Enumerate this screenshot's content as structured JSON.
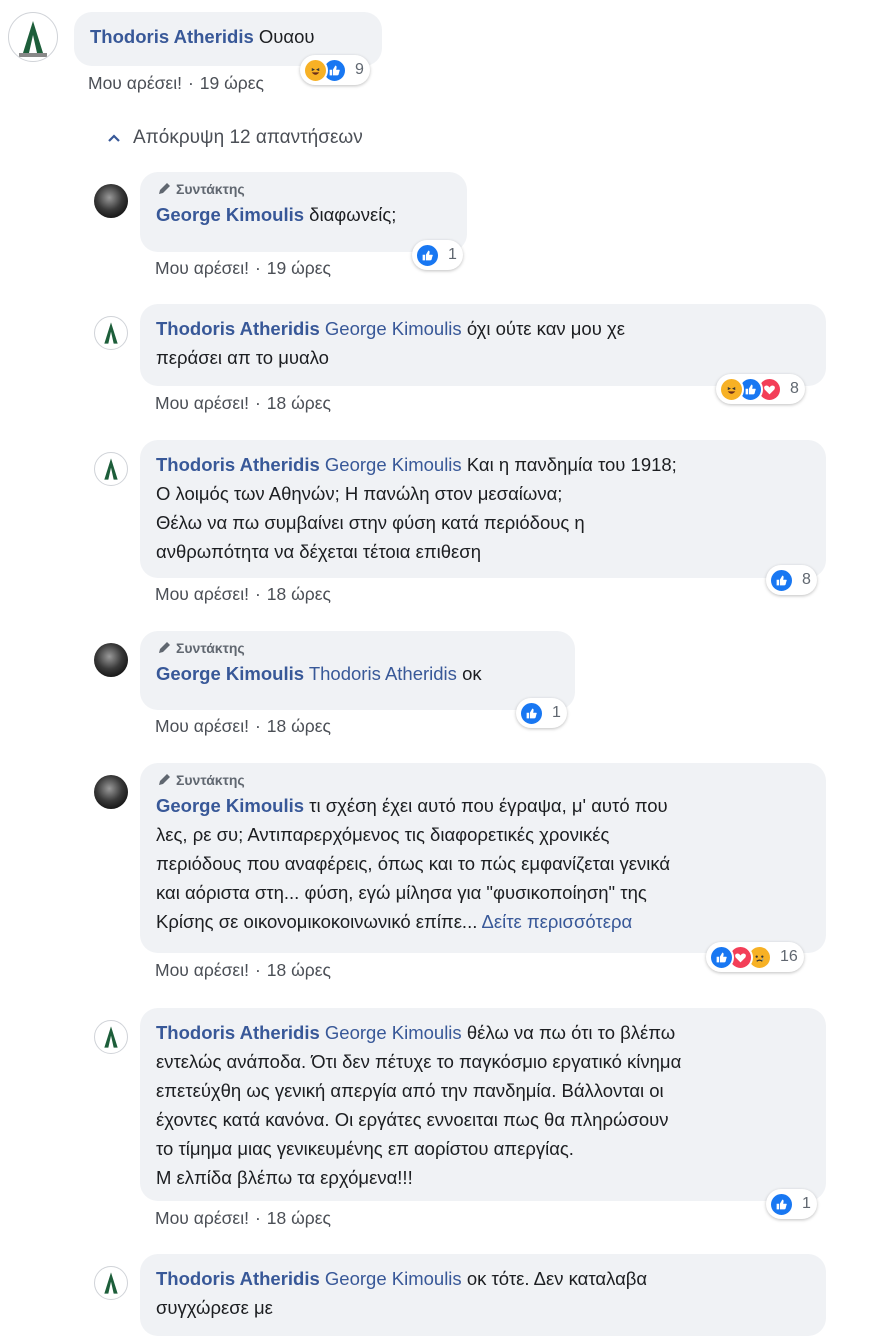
{
  "comments": [
    {
      "author": "Thodoris Atheridis",
      "editor": false,
      "text": "Ουαου",
      "like": "Μου αρέσει!",
      "time": "19 ώρες",
      "reactions": [
        "haha",
        "like"
      ],
      "count": "9"
    },
    {
      "author": "George Kimoulis",
      "editor": true,
      "text": "διαφωνείς;",
      "like": "Μου αρέσει!",
      "time": "19 ώρες",
      "reactions": [
        "like"
      ],
      "count": "1"
    },
    {
      "author": "Thodoris Atheridis",
      "editor": false,
      "tag": "George Kimoulis",
      "lines": [
        "όχι ούτε καν μου χε",
        "περάσει απ το μυαλο"
      ],
      "like": "Μου αρέσει!",
      "time": "18 ώρες",
      "reactions": [
        "haha",
        "like",
        "love"
      ],
      "count": "8"
    },
    {
      "author": "Thodoris Atheridis",
      "editor": false,
      "tag": "George Kimoulis",
      "lines": [
        "Και η πανδημία του 1918;",
        "Ο λοιμός των Αθηνών; Η πανώλη στον μεσαίωνα;",
        "Θέλω να πω συμβαίνει στην φύση κατά περιόδους η",
        "ανθρωπότητα να δέχεται τέτοια επιθεση"
      ],
      "like": "Μου αρέσει!",
      "time": "18 ώρες",
      "reactions": [
        "like"
      ],
      "count": "8"
    },
    {
      "author": "George Kimoulis",
      "editor": true,
      "tag": "Thodoris Atheridis",
      "text": "οκ",
      "like": "Μου αρέσει!",
      "time": "18 ώρες",
      "reactions": [
        "like"
      ],
      "count": "1"
    },
    {
      "author": "George Kimoulis",
      "editor": true,
      "lines": [
        "τι σχέση έχει αυτό που έγραψα, μ' αυτό που",
        "λες, ρε συ; Αντιπαρερχόμενος τις διαφορετικές χρονικές",
        "περιόδους που αναφέρεις, όπως και το πώς εμφανίζεται γενικά",
        "και αόριστα στη... φύση, εγώ μίλησα για \"φυσικοποίηση\" της",
        "Κρίσης σε οικονομικοκοινωνικό επίπε..."
      ],
      "see_more": "Δείτε περισσότερα",
      "like": "Μου αρέσει!",
      "time": "18 ώρες",
      "reactions": [
        "like",
        "love",
        "sad"
      ],
      "count": "16"
    },
    {
      "author": "Thodoris Atheridis",
      "editor": false,
      "tag": "George Kimoulis",
      "lines": [
        "θέλω να πω ότι το βλέπω",
        "εντελώς ανάποδα. Ότι δεν πέτυχε το παγκόσμιο εργατικό κίνημα",
        "επετεύχθη ως γενική απεργία από την πανδημία. Βάλλονται οι",
        "έχοντες κατά κανόνα. Οι εργάτες εννοειται πως θα πληρώσουν",
        "το τίμημα μιας γενικευμένης επ αορίστου απεργίας.",
        "Μ ελπίδα βλέπω τα ερχόμενα!!!"
      ],
      "like": "Μου αρέσει!",
      "time": "18 ώρες",
      "reactions": [
        "like"
      ],
      "count": "1"
    },
    {
      "author": "Thodoris Atheridis",
      "editor": false,
      "tag": "George Kimoulis",
      "lines": [
        "οκ τότε. Δεν καταλαβα",
        "συγχώρεσε με"
      ]
    }
  ],
  "editor_label": "Συντάκτης",
  "hide_replies": "Απόκρυψη 12 απαντήσεων",
  "colors": {
    "name": "#385898",
    "bubble": "#f0f2f5",
    "like": "#1877f2",
    "love": "#f33e58",
    "haha": "#f7b125"
  }
}
